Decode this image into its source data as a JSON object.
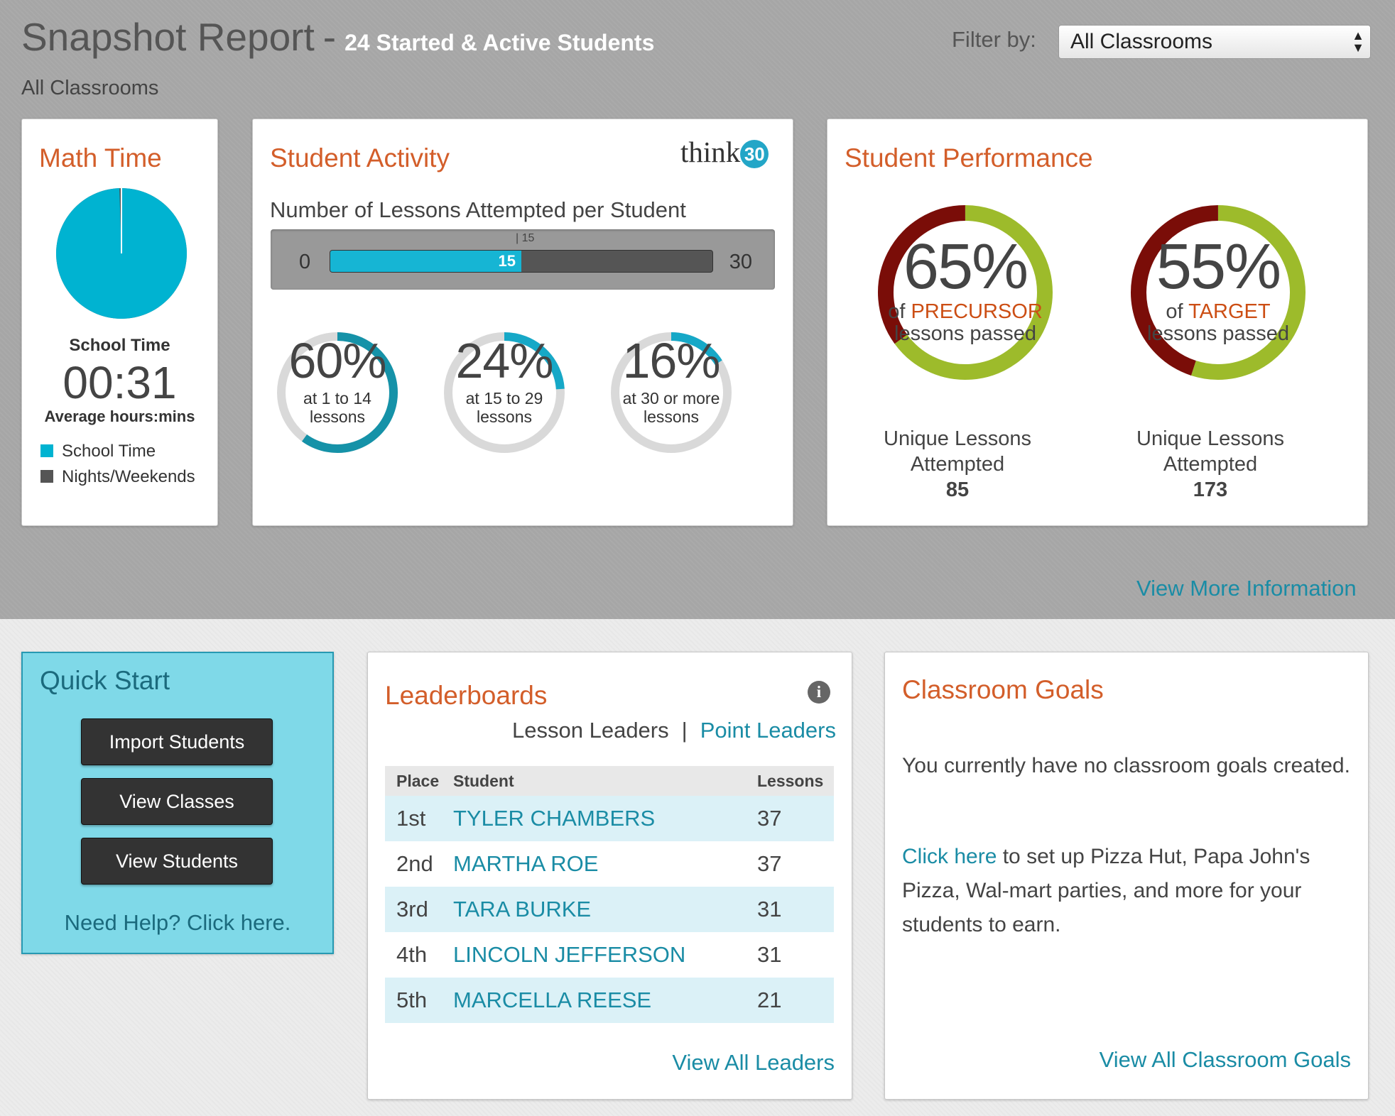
{
  "header": {
    "title": "Snapshot Report",
    "separator": "-",
    "subtitle": "24 Started & Active Students",
    "classroom_label": "All Classrooms",
    "filter_label": "Filter by:",
    "filter_value": "All Classrooms"
  },
  "math_time": {
    "title": "Math Time",
    "caption": "School Time",
    "value": "00:31",
    "value_caption": "Average hours:mins",
    "school_time_fraction": 0.995,
    "legend": [
      {
        "label": "School Time",
        "color": "#00b3d1"
      },
      {
        "label": "Nights/Weekends",
        "color": "#555555"
      }
    ]
  },
  "student_activity": {
    "title": "Student Activity",
    "logo_text": "think",
    "logo_badge": "30",
    "range_title": "Number of Lessons Attempted per Student",
    "range_min": "0",
    "range_max": "30",
    "range_value": 15,
    "range_value_label": "15",
    "range_marker_label": "| 15",
    "donuts": [
      {
        "percent": 60,
        "big": "60%",
        "line1": "at 1 to 14",
        "line2": "lessons",
        "color": "#1592a8"
      },
      {
        "percent": 24,
        "big": "24%",
        "line1": "at 15 to 29",
        "line2": "lessons",
        "color": "#16a8c7"
      },
      {
        "percent": 16,
        "big": "16%",
        "line1": "at 30 or more",
        "line2": "lessons",
        "color": "#16a8c7"
      }
    ]
  },
  "student_performance": {
    "title": "Student Performance",
    "rings": [
      {
        "percent": 65,
        "big": "65%",
        "of": "of",
        "accent": "PRECURSOR",
        "line2": "lessons passed",
        "under1": "Unique Lessons",
        "under2": "Attempted",
        "count": "85"
      },
      {
        "percent": 55,
        "big": "55%",
        "of": "of",
        "accent": "TARGET",
        "line2": "lessons passed",
        "under1": "Unique Lessons",
        "under2": "Attempted",
        "count": "173"
      }
    ],
    "pass_color": "#9dbb2b",
    "fail_color": "#7a0d08"
  },
  "view_more": "View More Information",
  "quick_start": {
    "title": "Quick Start",
    "buttons": [
      "Import Students",
      "View Classes",
      "View Students"
    ],
    "help": "Need Help? Click here."
  },
  "leaderboards": {
    "title": "Leaderboards",
    "info": "i",
    "tab_active": "Lesson Leaders",
    "tab_separator": "|",
    "tab_other": "Point Leaders",
    "columns": [
      "Place",
      "Student",
      "Lessons"
    ],
    "rows": [
      {
        "place": "1st",
        "student": "TYLER CHAMBERS",
        "lessons": "37"
      },
      {
        "place": "2nd",
        "student": "MARTHA ROE",
        "lessons": "37"
      },
      {
        "place": "3rd",
        "student": "TARA BURKE",
        "lessons": "31"
      },
      {
        "place": "4th",
        "student": "LINCOLN JEFFERSON",
        "lessons": "31"
      },
      {
        "place": "5th",
        "student": "MARCELLA REESE",
        "lessons": "21"
      }
    ],
    "view_all": "View All Leaders"
  },
  "classroom_goals": {
    "title": "Classroom Goals",
    "empty_text": "You currently have no classroom goals created.",
    "link_text": "Click here",
    "link_rest": " to set up Pizza Hut, Papa John's Pizza, Wal-mart parties, and more for your students to earn.",
    "view_all": "View All Classroom Goals"
  }
}
